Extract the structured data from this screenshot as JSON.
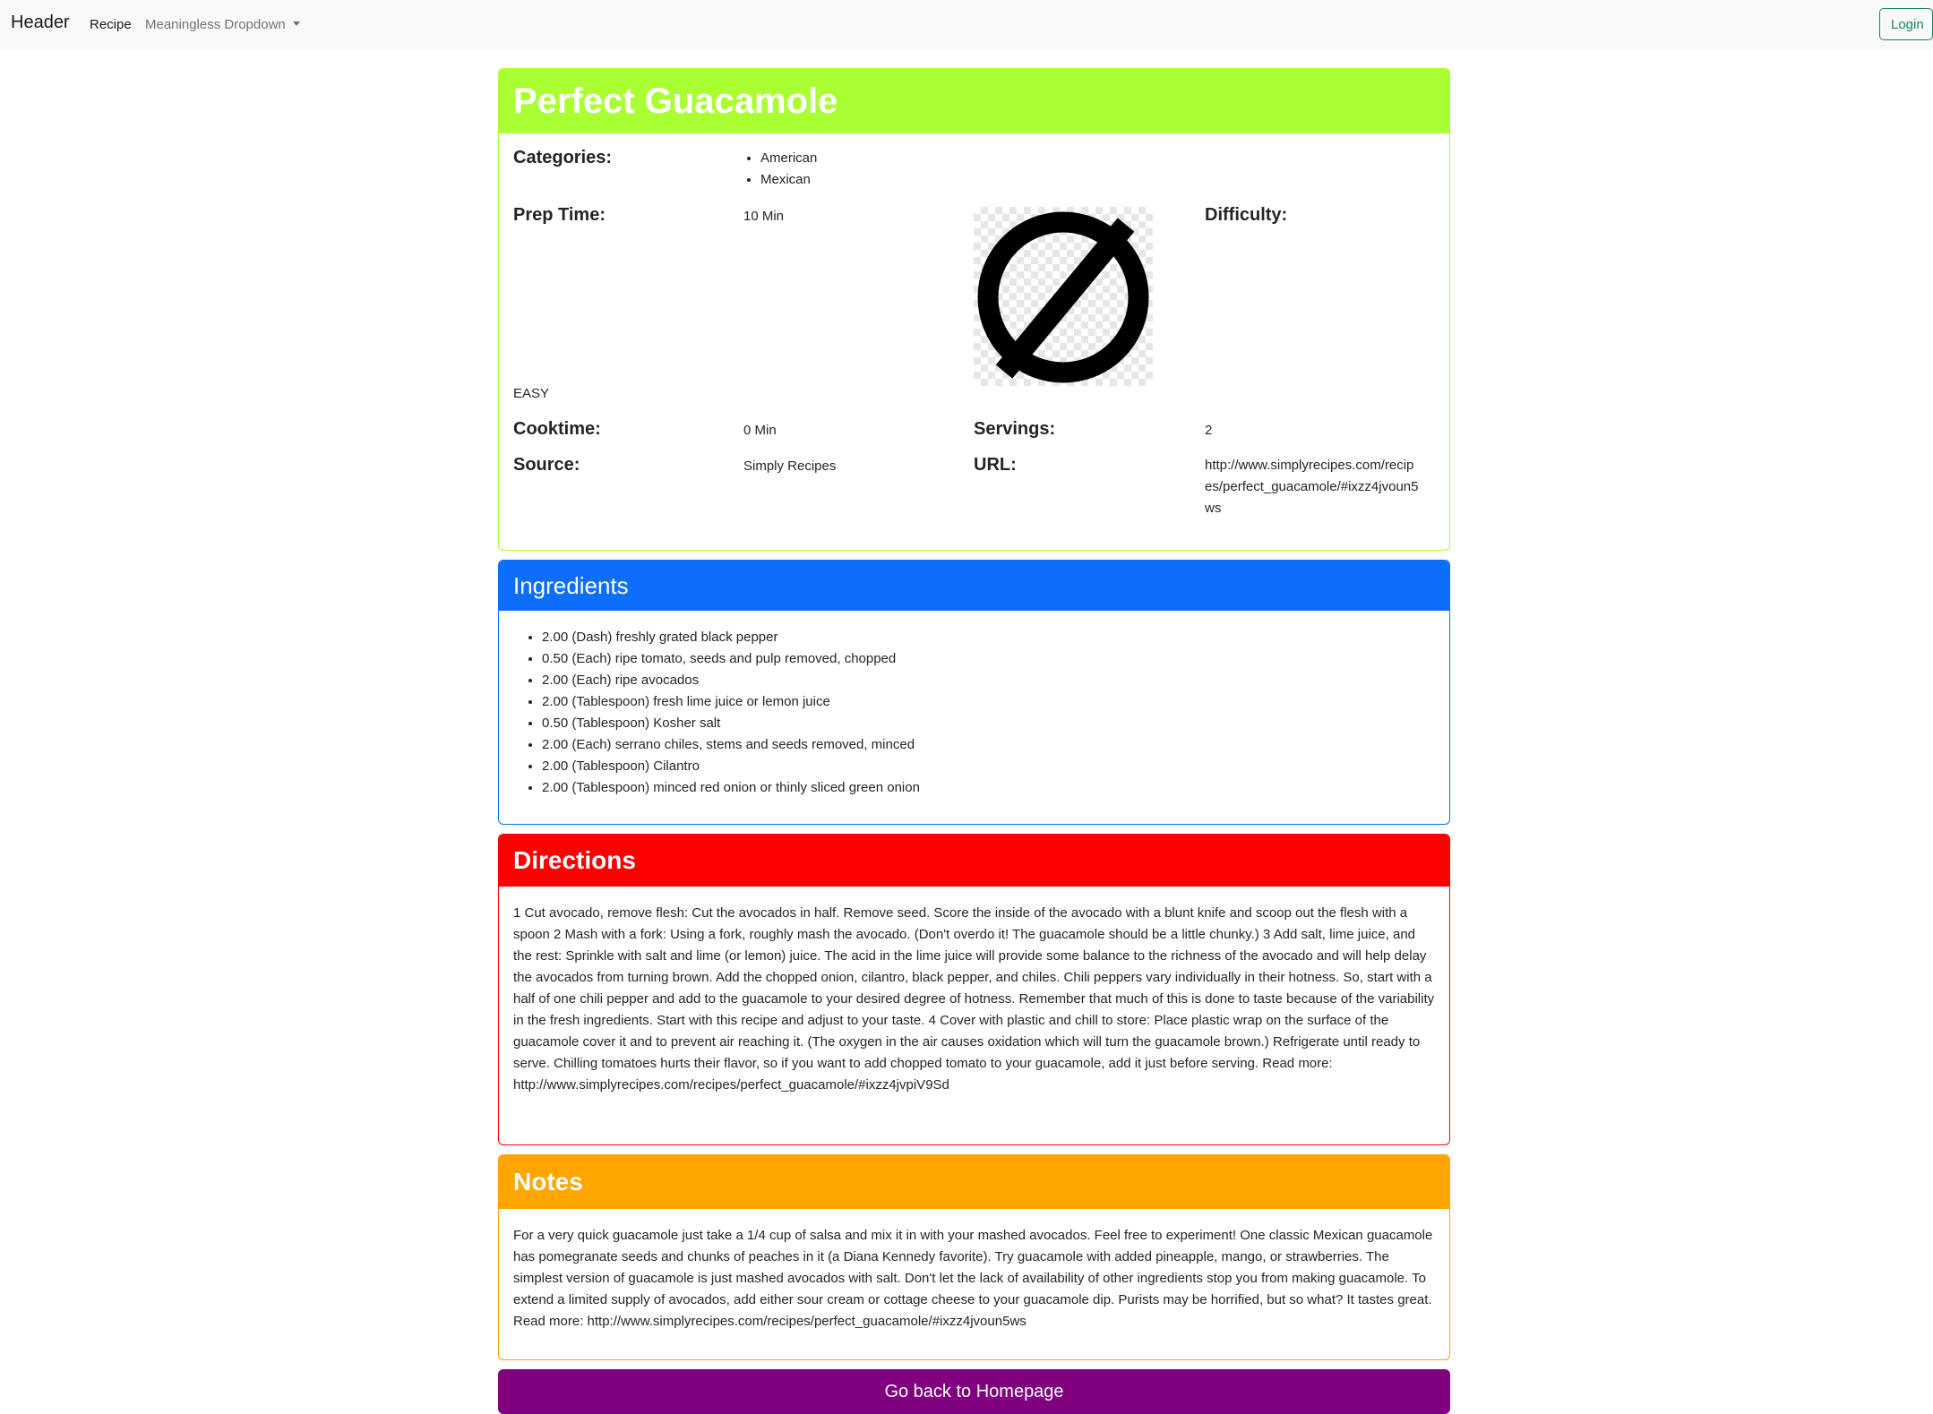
{
  "navbar": {
    "brand": "Header",
    "links": [
      {
        "label": "Recipe"
      },
      {
        "label": "Meaningless Dropdown"
      }
    ],
    "login_label": "Login"
  },
  "recipe": {
    "title": "Perfect Guacamole",
    "categories_label": "Categories:",
    "categories": [
      "American",
      "Mexican"
    ],
    "prep_time_label": "Prep Time:",
    "prep_time": "10 Min",
    "difficulty_label": "Difficulty:",
    "difficulty": "EASY",
    "cooktime_label": "Cooktime:",
    "cooktime": "0 Min",
    "servings_label": "Servings:",
    "servings": "2",
    "source_label": "Source:",
    "source": "Simply Recipes",
    "url_label": "URL:",
    "url": "http://www.simplyrecipes.com/recipes/perfect_guacamole/#ixzz4jvoun5ws",
    "image_icon": "no-image-placeholder-icon"
  },
  "ingredients": {
    "title": "Ingredients",
    "items": [
      "2.00 (Dash) freshly grated black pepper",
      "0.50 (Each) ripe tomato, seeds and pulp removed, chopped",
      "2.00 (Each) ripe avocados",
      "2.00 (Tablespoon) fresh lime juice or lemon juice",
      "0.50 (Tablespoon) Kosher salt",
      "2.00 (Each) serrano chiles, stems and seeds removed, minced",
      "2.00 (Tablespoon) Cilantro",
      "2.00 (Tablespoon) minced red onion or thinly sliced green onion"
    ]
  },
  "directions": {
    "title": "Directions",
    "text": "1 Cut avocado, remove flesh: Cut the avocados in half. Remove seed. Score the inside of the avocado with a blunt knife and scoop out the flesh with a spoon 2 Mash with a fork: Using a fork, roughly mash the avocado. (Don't overdo it! The guacamole should be a little chunky.) 3 Add salt, lime juice, and the rest: Sprinkle with salt and lime (or lemon) juice. The acid in the lime juice will provide some balance to the richness of the avocado and will help delay the avocados from turning brown. Add the chopped onion, cilantro, black pepper, and chiles. Chili peppers vary individually in their hotness. So, start with a half of one chili pepper and add to the guacamole to your desired degree of hotness. Remember that much of this is done to taste because of the variability in the fresh ingredients. Start with this recipe and adjust to your taste. 4 Cover with plastic and chill to store: Place plastic wrap on the surface of the guacamole cover it and to prevent air reaching it. (The oxygen in the air causes oxidation which will turn the guacamole brown.) Refrigerate until ready to serve. Chilling tomatoes hurts their flavor, so if you want to add chopped tomato to your guacamole, add it just before serving. Read more: http://www.simplyrecipes.com/recipes/perfect_guacamole/#ixzz4jvpiV9Sd"
  },
  "notes": {
    "title": "Notes",
    "text": "For a very quick guacamole just take a 1/4 cup of salsa and mix it in with your mashed avocados. Feel free to experiment! One classic Mexican guacamole has pomegranate seeds and chunks of peaches in it (a Diana Kennedy favorite). Try guacamole with added pineapple, mango, or strawberries. The simplest version of guacamole is just mashed avocados with salt. Don't let the lack of availability of other ingredients stop you from making guacamole. To extend a limited supply of avocados, add either sour cream or cottage cheese to your guacamole dip. Purists may be horrified, but so what? It tastes great. Read more: http://www.simplyrecipes.com/recipes/perfect_guacamole/#ixzz4jvoun5ws"
  },
  "footer": {
    "home_button_label": "Go back to Homepage"
  },
  "colors": {
    "recipe_header": "#aaff33",
    "ingredients_header": "#0d6efd",
    "directions_header": "#ff0000",
    "notes_header": "#ffa500",
    "home_button": "#800080",
    "login_button": "#198754"
  }
}
